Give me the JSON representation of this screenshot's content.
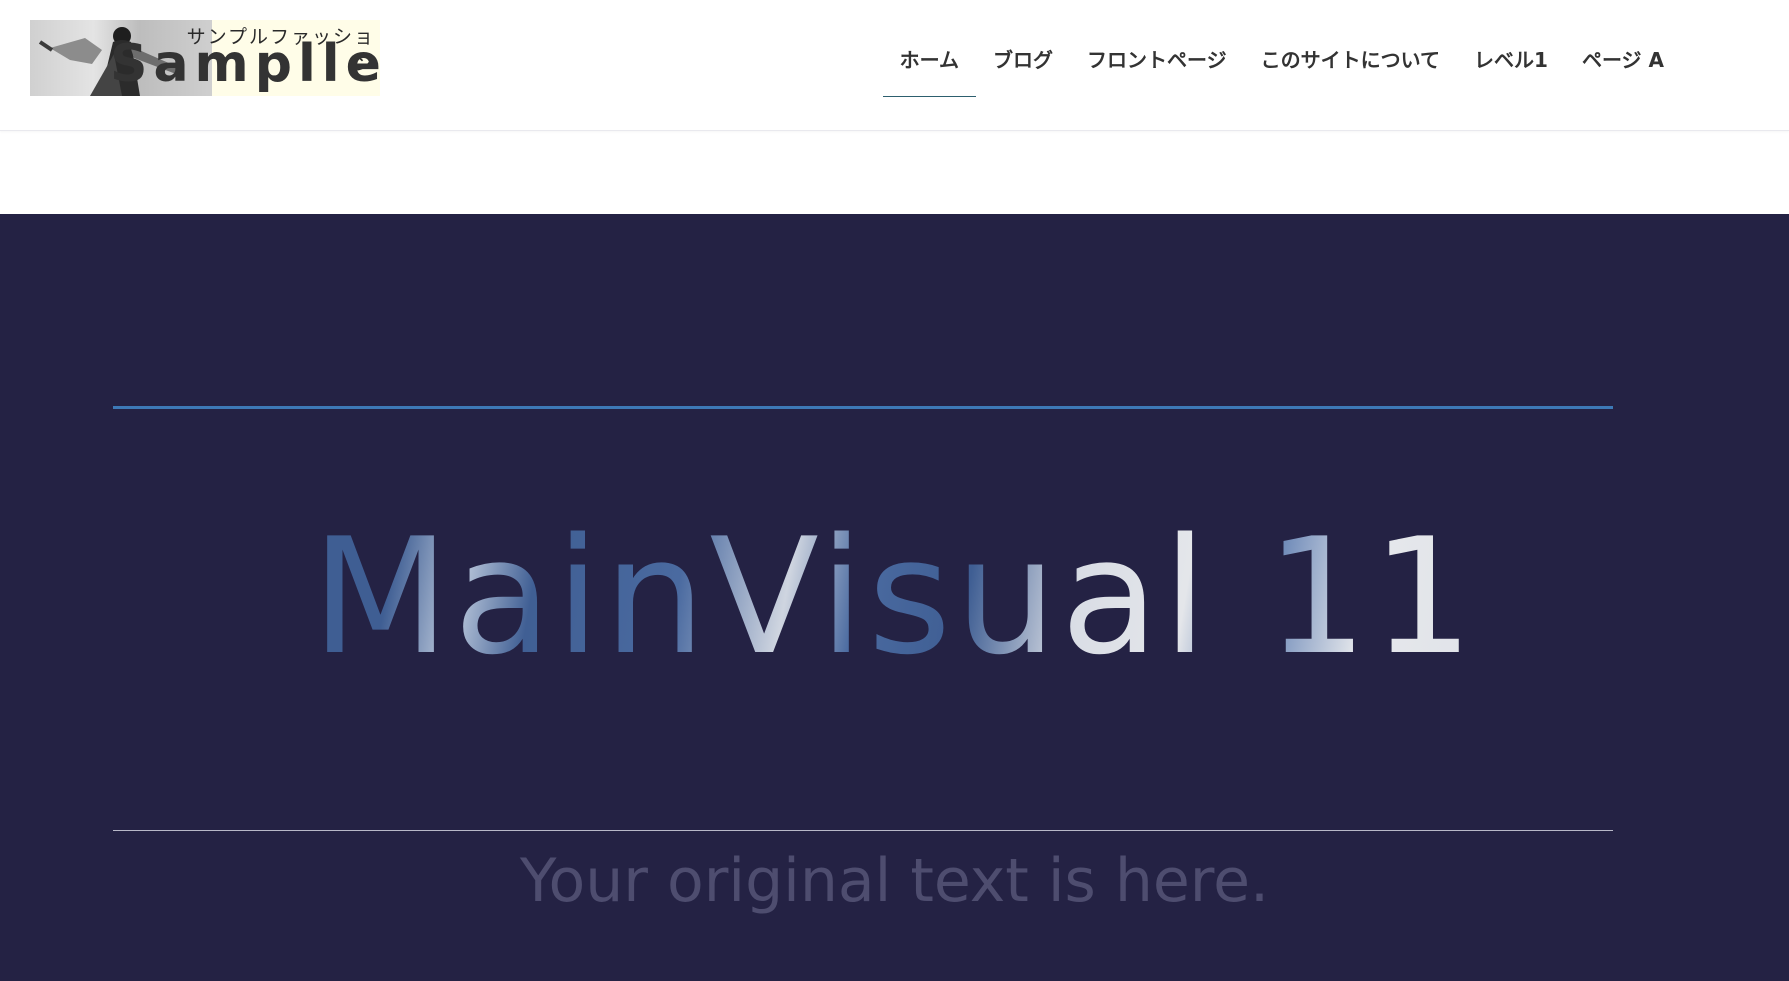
{
  "logo": {
    "kana": "サンプルファッション",
    "word": "Samplle"
  },
  "nav": {
    "items": [
      {
        "label": "ホーム",
        "active": true
      },
      {
        "label": "ブログ",
        "active": false
      },
      {
        "label": "フロントページ",
        "active": false
      },
      {
        "label": "このサイトについて",
        "active": false
      },
      {
        "label": "レベル1",
        "active": false
      },
      {
        "label": "ページ A",
        "active": false
      }
    ]
  },
  "hero": {
    "title": "MainVisual 11",
    "subtitle": "Your original text is here."
  },
  "colors": {
    "hero_background": "#242244",
    "accent_line": "#3d79b6",
    "nav_active_underline": "#2d5f6e",
    "text_dark": "#333333"
  }
}
